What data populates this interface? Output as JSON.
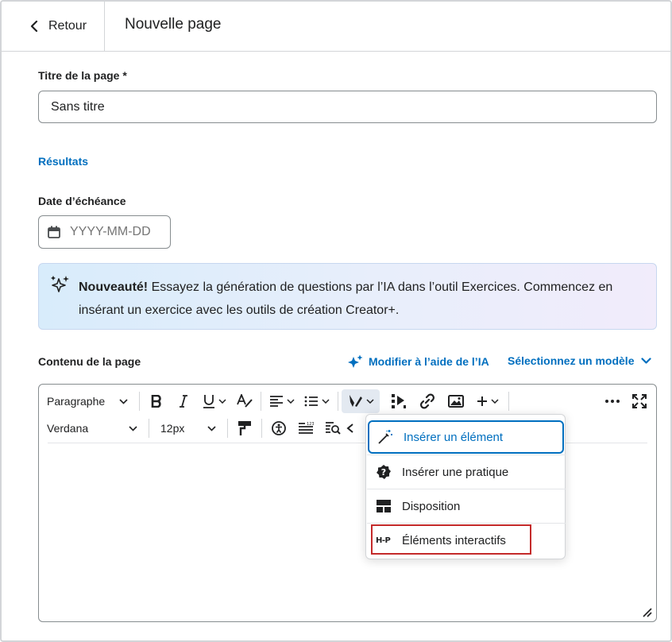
{
  "header": {
    "back_label": "Retour",
    "title": "Nouvelle page"
  },
  "form": {
    "title_label": "Titre de la page *",
    "title_value": "Sans titre",
    "results_link": "Résultats",
    "due_date_label": "Date d’échéance",
    "due_date_placeholder": "YYYY-MM-DD"
  },
  "banner": {
    "bold": "Nouveauté!",
    "text": " Essayez la génération de questions par l’IA dans l’outil Exercices. Commencez en insérant un exercice avec les outils de création Creator+."
  },
  "content": {
    "label": "Contenu de la page",
    "ai_link": "Modifier à l’aide de l’IA",
    "template_link": "Sélectionnez un modèle"
  },
  "toolbar": {
    "paragraph_select": "Paragraphe",
    "font_select": "Verdana",
    "size_select": "12px"
  },
  "insert_menu": {
    "items": [
      {
        "label": "Insérer un élément",
        "icon": "magic-wand-icon"
      },
      {
        "label": "Insérer une pratique",
        "icon": "question-badge-icon"
      },
      {
        "label": "Disposition",
        "icon": "layout-icon"
      },
      {
        "label": "Éléments interactifs",
        "icon": "h5p-icon",
        "badge": "H-P"
      }
    ]
  },
  "colors": {
    "accent": "#006fbf",
    "highlight": "#c42a2a",
    "text": "#202122",
    "border": "#868c8f"
  }
}
